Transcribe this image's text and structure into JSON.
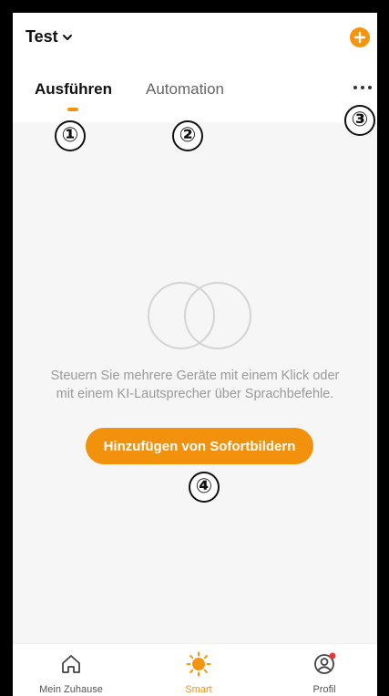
{
  "header": {
    "home_name": "Test",
    "tabs": [
      {
        "label": "Ausführen",
        "active": true
      },
      {
        "label": "Automation",
        "active": false
      }
    ],
    "more_icon": "more-horizontal-icon",
    "add_icon": "plus-circle-icon"
  },
  "annotations": [
    "①",
    "②",
    "③",
    "④"
  ],
  "empty_state": {
    "icon": "overlapping-circles-icon",
    "message_line1": "Steuern Sie mehrere Geräte mit einem Klick oder",
    "message_line2": "mit einem KI-Lautsprecher über Sprachbefehle.",
    "button_label": "Hinzufügen von Sofortbildern"
  },
  "bottom_nav": {
    "items": [
      {
        "label": "Mein Zuhause",
        "icon": "home-icon",
        "active": false
      },
      {
        "label": "Smart",
        "icon": "sun-icon",
        "active": true
      },
      {
        "label": "Profil",
        "icon": "profile-icon",
        "active": false,
        "notification_dot": true
      }
    ]
  },
  "colors": {
    "accent": "#f5940e",
    "notification": "#e53935",
    "muted_text": "#9a9a9a"
  }
}
